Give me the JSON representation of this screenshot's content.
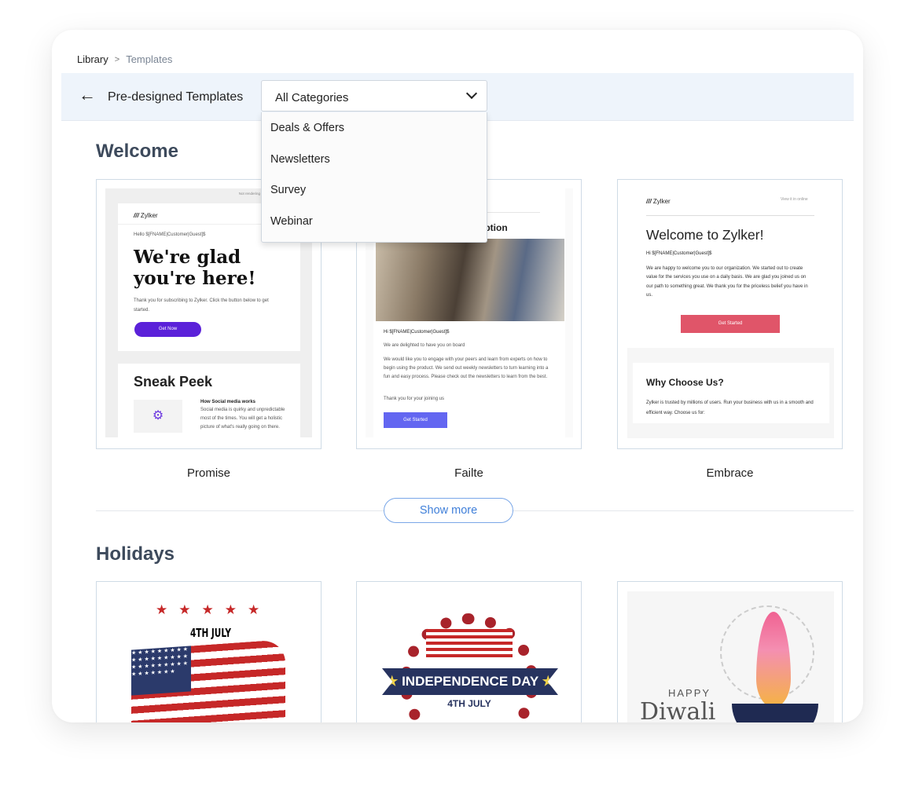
{
  "breadcrumb": {
    "root": "Library",
    "current": "Templates"
  },
  "header": {
    "title": "Pre-designed Templates",
    "category_selected": "All Categories",
    "category_options": [
      "Deals & Offers",
      "Newsletters",
      "Survey",
      "Webinar"
    ]
  },
  "sections": [
    {
      "title": "Welcome",
      "show_more": "Show more",
      "templates": [
        {
          "name": "Promise",
          "preview": {
            "top_note": "Not rendering correctly? View this email",
            "logo": "Zylker",
            "greeting": "Hello $[FNAME|Customer|Guest]$",
            "headline": "We're glad you're here!",
            "body": "Thank you for subscribing to Zylker. Click the button below to get started.",
            "button": "Get Now",
            "button_color": "#5b21d9",
            "section2_title": "Sneak Peek",
            "section2_subtitle": "How Social media works",
            "section2_text": "Social media is quirky and unpredictable most of the times. You will get a holistic picture of what's really going on there."
          }
        },
        {
          "name": "Failte",
          "preview": {
            "heading_visible": "scription",
            "greeting": "Hi $[FNAME|Customer|Guest]$",
            "line1": "We are delighted to have you on board",
            "body": "We would like you to engage with your peers and learn from experts on how to begin using the product. We send out weekly newsletters to turn learning into a fun and easy process. Please check out the newsletters to learn from the best.",
            "thanks": "Thank you for your joining us",
            "button": "Get Started",
            "button_color": "#6366f1"
          }
        },
        {
          "name": "Embrace",
          "preview": {
            "logo": "Zylker",
            "view_online": "View it in online",
            "headline": "Welcome to Zylker!",
            "greeting": "Hi $[FNAME|Customer|Guest]$",
            "body": "We are happy to welcome you to our organization. We started out to create value for the services you use on a daily basis. We are glad you joined us on our path to something great. We thank you for the priceless belief you have in us.",
            "button": "Get Started",
            "button_color": "#e05569",
            "section2_title": "Why Choose Us?",
            "section2_text": "Zylker is trusted by millions of users. Run your business with us in a smooth and efficient way. Choose us for:"
          }
        }
      ]
    },
    {
      "title": "Holidays",
      "templates": [
        {
          "preview": {
            "text": "4TH JULY"
          }
        },
        {
          "preview": {
            "banner": "INDEPENDENCE DAY",
            "sub": "4TH JULY"
          }
        },
        {
          "preview": {
            "happy": "HAPPY",
            "title": "Diwali"
          }
        }
      ]
    }
  ],
  "colors": {
    "header_band": "#eef4fb",
    "accent": "#3f7fd9",
    "heading": "#3d4a5c"
  }
}
